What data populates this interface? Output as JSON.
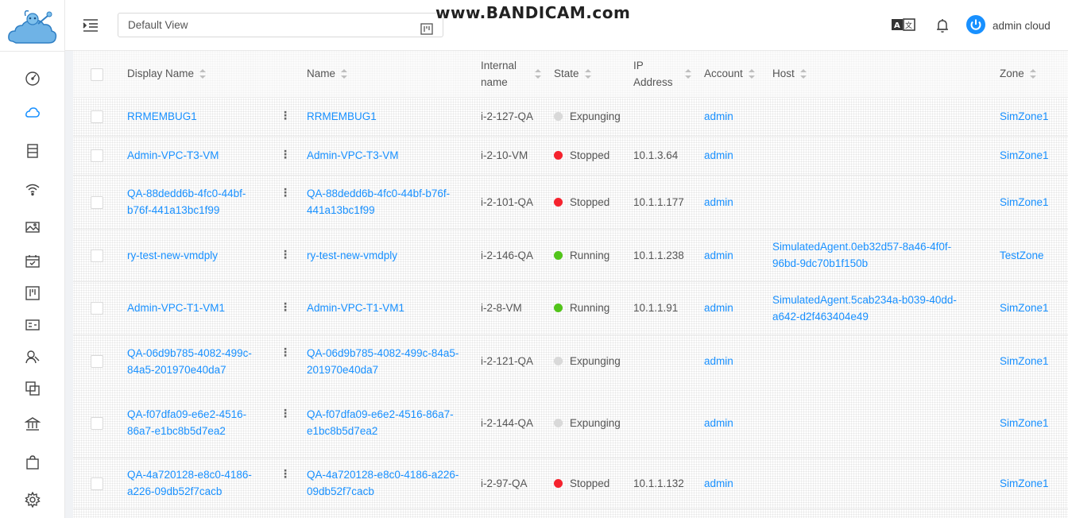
{
  "header": {
    "view_selector": "Default View",
    "watermark": "www.BANDICAM.com",
    "user_name": "admin cloud"
  },
  "colors": {
    "link": "#1890ff",
    "running": "#52c41a",
    "stopped": "#f5222d",
    "expunging": "#d9d9d9",
    "user_icon": "#1890ff"
  },
  "sidebar": {
    "icons": [
      "dashboard-icon",
      "cloud-icon",
      "storage-icon",
      "wifi-icon",
      "image-icon",
      "calendar-icon",
      "project-icon",
      "id-card-icon",
      "users-icon",
      "block-icon",
      "bank-icon",
      "bag-icon",
      "settings-icon"
    ]
  },
  "table": {
    "columns": [
      "Display Name",
      "Name",
      "Internal name",
      "State",
      "IP Address",
      "Account",
      "Host",
      "Zone"
    ],
    "rows": [
      {
        "display_name": "RRMEMBUG1",
        "name": "RRMEMBUG1",
        "internal_name": "i-2-127-QA",
        "state": "Expunging",
        "ip": "",
        "account": "admin",
        "host": "",
        "zone": "SimZone1"
      },
      {
        "display_name": "Admin-VPC-T3-VM",
        "name": "Admin-VPC-T3-VM",
        "internal_name": "i-2-10-VM",
        "state": "Stopped",
        "ip": "10.1.3.64",
        "account": "admin",
        "host": "",
        "zone": "SimZone1"
      },
      {
        "display_name": "QA-88dedd6b-4fc0-44bf-b76f-441a13bc1f99",
        "name": "QA-88dedd6b-4fc0-44bf-b76f-441a13bc1f99",
        "internal_name": "i-2-101-QA",
        "state": "Stopped",
        "ip": "10.1.1.177",
        "account": "admin",
        "host": "",
        "zone": "SimZone1"
      },
      {
        "display_name": "ry-test-new-vmdply",
        "name": "ry-test-new-vmdply",
        "internal_name": "i-2-146-QA",
        "state": "Running",
        "ip": "10.1.1.238",
        "account": "admin",
        "host": "SimulatedAgent.0eb32d57-8a46-4f0f-96bd-9dc70b1f150b",
        "zone": "TestZone"
      },
      {
        "display_name": "Admin-VPC-T1-VM1",
        "name": "Admin-VPC-T1-VM1",
        "internal_name": "i-2-8-VM",
        "state": "Running",
        "ip": "10.1.1.91",
        "account": "admin",
        "host": "SimulatedAgent.5cab234a-b039-40dd-a642-d2f463404e49",
        "zone": "SimZone1"
      },
      {
        "display_name": "QA-06d9b785-4082-499c-84a5-201970e40da7",
        "name": "QA-06d9b785-4082-499c-84a5-201970e40da7",
        "internal_name": "i-2-121-QA",
        "state": "Expunging",
        "ip": "",
        "account": "admin",
        "host": "",
        "zone": "SimZone1"
      },
      {
        "display_name": "QA-f07dfa09-e6e2-4516-86a7-e1bc8b5d7ea2",
        "name": "QA-f07dfa09-e6e2-4516-86a7-e1bc8b5d7ea2",
        "internal_name": "i-2-144-QA",
        "state": "Expunging",
        "ip": "",
        "account": "admin",
        "host": "",
        "zone": "SimZone1"
      },
      {
        "display_name": "QA-4a720128-e8c0-4186-a226-09db52f7cacb",
        "name": "QA-4a720128-e8c0-4186-a226-09db52f7cacb",
        "internal_name": "i-2-97-QA",
        "state": "Stopped",
        "ip": "10.1.1.132",
        "account": "admin",
        "host": "",
        "zone": "SimZone1"
      }
    ]
  }
}
